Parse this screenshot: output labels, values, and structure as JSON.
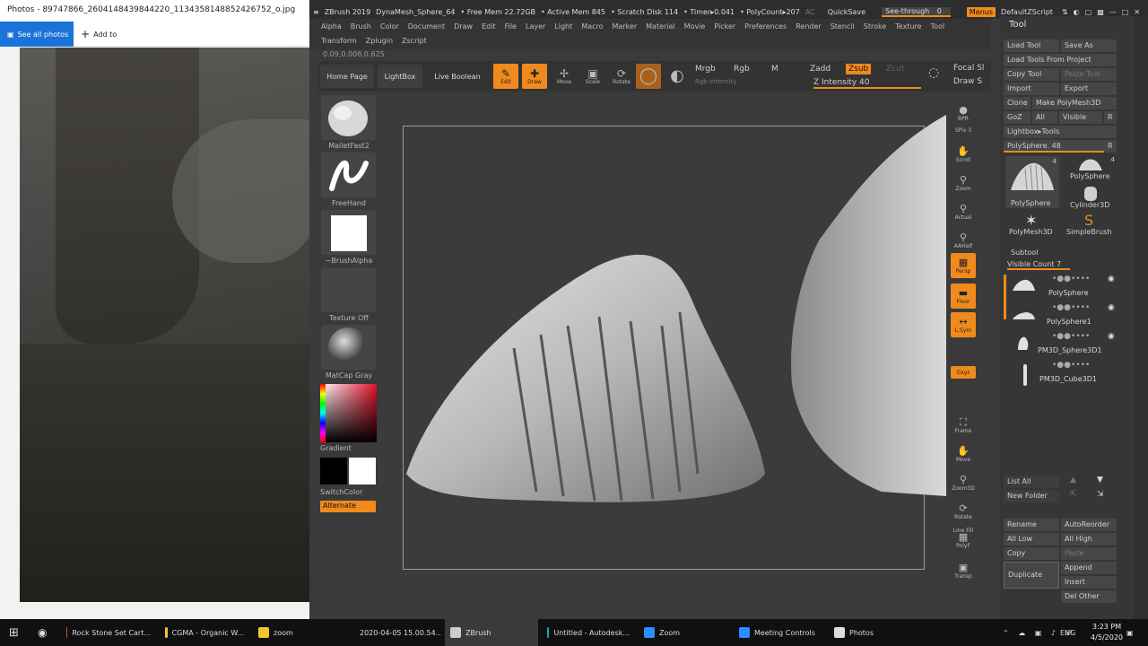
{
  "photos": {
    "title": "Photos - 89747866_2604148439844220_1134358148852426752_o.jpg",
    "see_all": "See all photos",
    "add_to": "Add to"
  },
  "zbrush": {
    "title_items": [
      "ZBrush 2019",
      "DynaMesh_Sphere_64",
      "• Free Mem 22.72GB",
      "• Active Mem 845",
      "• Scratch Disk 114",
      "• Timer▸0.041",
      "• PolyCount▸207",
      "AC"
    ],
    "quicksave": "QuickSave",
    "seethrough": "See-through",
    "seethrough_val": "0",
    "menus": "Menus",
    "default_zscript": "DefaultZScript",
    "menu_row1": [
      "Alpha",
      "Brush",
      "Color",
      "Document",
      "Draw",
      "Edit",
      "File",
      "Layer",
      "Light",
      "Macro",
      "Marker",
      "Material",
      "Movie",
      "Picker",
      "Preferences",
      "Render",
      "Stencil",
      "Stroke",
      "Texture",
      "Tool"
    ],
    "menu_row2": [
      "Transform",
      "Zplugin",
      "Zscript"
    ],
    "coord": "0.09,0.008,0.625",
    "topbar": {
      "home": "Home Page",
      "lightbox": "LightBox",
      "live_boolean": "Live Boolean",
      "edit": "Edit",
      "draw": "Draw",
      "move": "Move",
      "scale": "Scale",
      "rotate": "Rotate",
      "mrgb": "Mrgb",
      "rgb": "Rgb",
      "m": "M",
      "rgb_intensity": "Rgb Intensity",
      "zadd": "Zadd",
      "zsub": "Zsub",
      "zcut": "Zcut",
      "z_intensity": "Z Intensity 40",
      "focal": "Focal Sl",
      "draw_s": "Draw S"
    },
    "left_shelf": {
      "brush": "MalletFast2",
      "stroke": "FreeHand",
      "alpha": "~BrushAlpha",
      "texture": "Texture Off",
      "material": "MatCap Gray",
      "gradient": "Gradient",
      "switchcolor": "SwitchColor",
      "alternate": "Alternate"
    },
    "right_shelf": {
      "bpr": "BPR",
      "spix": "SPix 3",
      "scroll": "Scroll",
      "zoom": "Zoom",
      "actual": "Actual",
      "aahalf": "AAHalf",
      "persp": "Persp",
      "floor": "Floor",
      "lsym": "L.Sym",
      "xyz": "Gxyz",
      "frame": "Frame",
      "move": "Move",
      "zoom3d": "Zoom3D",
      "rotate": "Rotate",
      "polyf": "PolyF",
      "line_fill": "Line Fill",
      "transp": "Transp"
    },
    "tool": {
      "title": "Tool",
      "load_tool": "Load Tool",
      "save_as": "Save As",
      "load_from_project": "Load Tools From Project",
      "copy_tool": "Copy Tool",
      "paste_tool": "Paste Tool",
      "import": "Import",
      "export": "Export",
      "clone": "Clone",
      "make_polymesh": "Make PolyMesh3D",
      "goz": "GoZ",
      "all": "All",
      "visible": "Visible",
      "r": "R",
      "lightbox_tools": "Lightbox▸Tools",
      "polysphere_slider": "PolySphere. 48",
      "thumbs": [
        {
          "name": "PolySphere",
          "count": "4"
        },
        {
          "name": "PolySphere",
          "count": "4"
        },
        {
          "name": "Cylinder3D",
          "count": ""
        },
        {
          "name": "PolyMesh3D",
          "count": ""
        },
        {
          "name": "SimpleBrush",
          "count": ""
        }
      ],
      "subtool": "Subtool",
      "visible_count": "Visible Count 7",
      "subtools": [
        "PolySphere",
        "PolySphere1",
        "PM3D_Sphere3D1",
        "PM3D_Cube3D1"
      ],
      "list_all": "List All",
      "new_folder": "New Folder",
      "rename": "Rename",
      "autoreorder": "AutoReorder",
      "all_low": "All Low",
      "all_high": "All High",
      "copy": "Copy",
      "paste": "Paste",
      "duplicate": "Duplicate",
      "append": "Append",
      "insert": "Insert",
      "del_other": "Del Other"
    }
  },
  "taskbar": {
    "items": [
      {
        "label": "Rock Stone Set Cart...",
        "color": "#e94235"
      },
      {
        "label": "CGMA - Organic W...",
        "color": "#f4c430"
      },
      {
        "label": "zoom",
        "color": "#f4c430"
      },
      {
        "label": "2020-04-05 15.00.54...",
        "color": "#f4c430"
      },
      {
        "label": "ZBrush",
        "color": "#cccccc"
      },
      {
        "label": "Untitled - Autodesk...",
        "color": "#1fa7a0"
      },
      {
        "label": "Zoom",
        "color": "#2d8cff"
      },
      {
        "label": "Meeting Controls",
        "color": "#2d8cff"
      },
      {
        "label": "Photos",
        "color": "#dddddd"
      }
    ],
    "lang": "ENG",
    "time": "3:23 PM",
    "date": "4/5/2020"
  }
}
